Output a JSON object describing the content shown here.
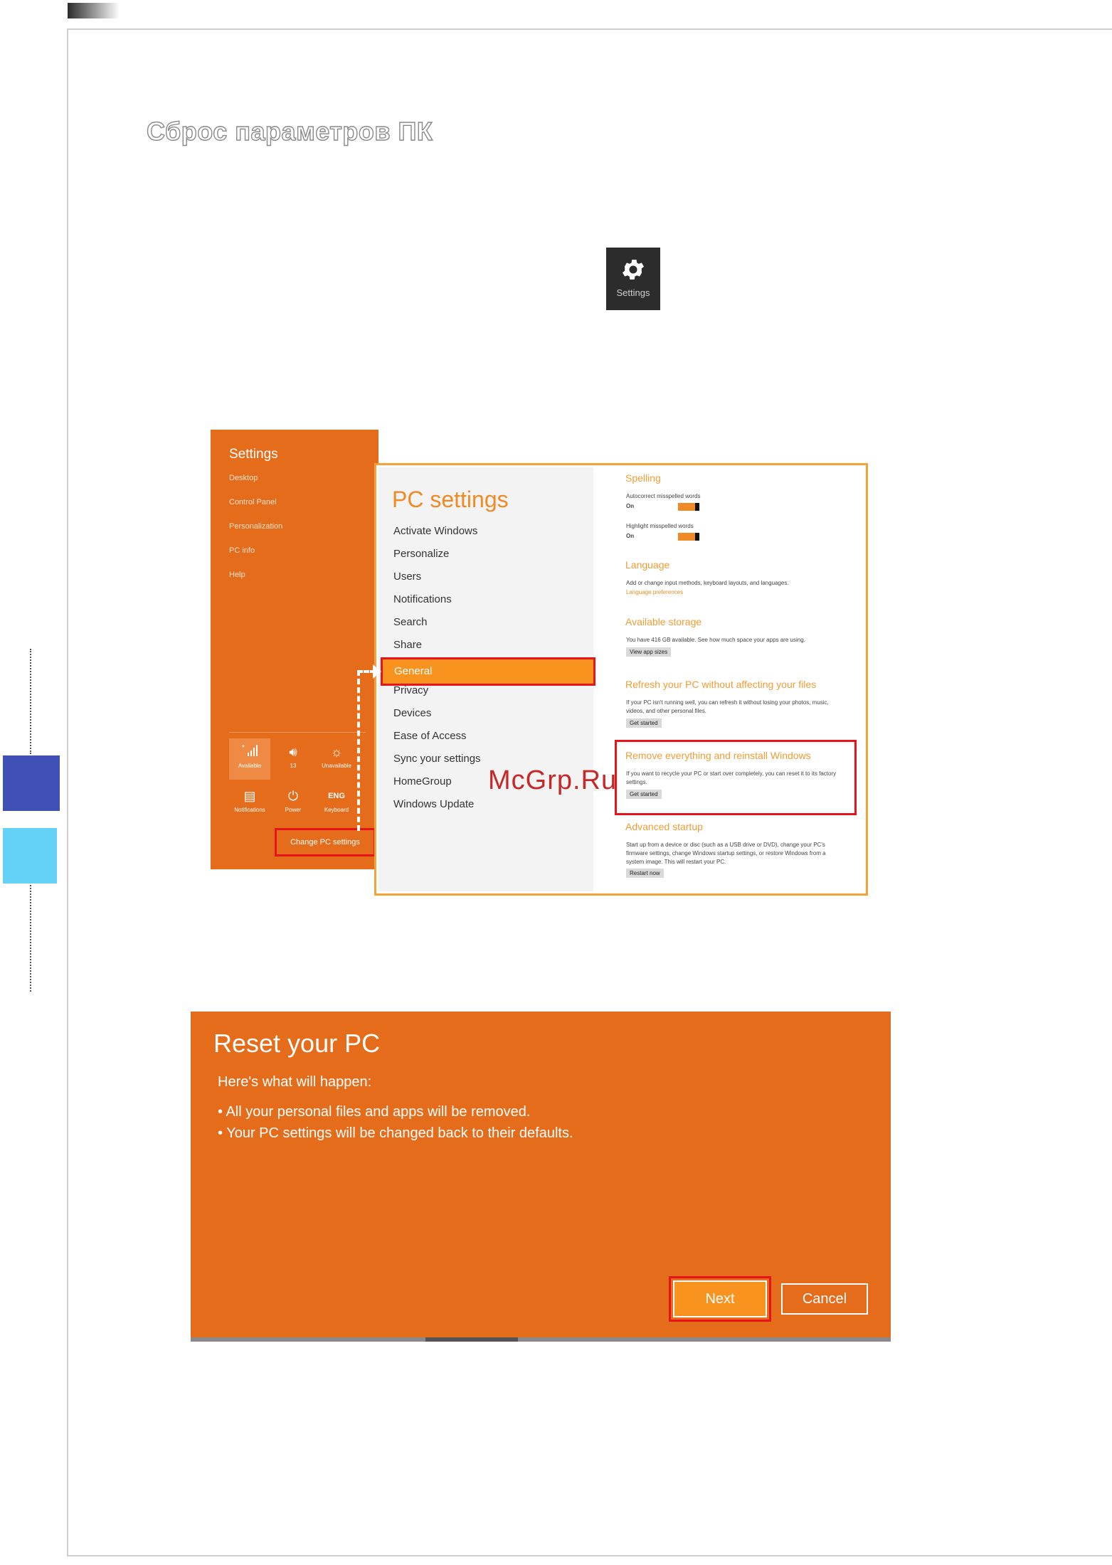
{
  "heading": "Сброс параметров ПК",
  "settings_tile": {
    "label": "Settings"
  },
  "charm": {
    "title": "Settings",
    "links": [
      "Desktop",
      "Control Panel",
      "Personalization",
      "PC info",
      "Help"
    ],
    "quick": [
      {
        "icon": "signal-icon",
        "label": "Available"
      },
      {
        "icon": "volume-icon",
        "label": "13"
      },
      {
        "icon": "brightness-icon",
        "label": "Unavailable"
      },
      {
        "icon": "notifications-icon",
        "label": "Notifications"
      },
      {
        "icon": "power-icon",
        "label": "Power"
      },
      {
        "icon": "keyboard-icon",
        "label": "Keyboard",
        "glyph": "ENG"
      }
    ],
    "change_pc": "Change PC settings"
  },
  "pc_settings": {
    "title": "PC settings",
    "nav": [
      "Activate Windows",
      "Personalize",
      "Users",
      "Notifications",
      "Search",
      "Share",
      "General",
      "Privacy",
      "Devices",
      "Ease of Access",
      "Sync your settings",
      "HomeGroup",
      "Windows Update"
    ],
    "selected": "General",
    "right": {
      "spelling_h": "Spelling",
      "autocorrect": "Autocorrect misspelled words",
      "highlight": "Highlight misspelled words",
      "on": "On",
      "language_h": "Language",
      "language_text": "Add or change input methods, keyboard layouts, and languages.",
      "language_link": "Language preferences",
      "storage_h": "Available storage",
      "storage_text": "You have 416 GB available. See how much space your apps are using.",
      "view_sizes": "View app sizes",
      "refresh_h": "Refresh your PC without affecting your files",
      "refresh_text1": "If your PC isn't running well, you can refresh it without losing your photos, music,",
      "refresh_text2": "videos, and other personal files.",
      "get_started": "Get started",
      "remove_h": "Remove everything and reinstall Windows",
      "remove_text1": "If you want to recycle your PC or start over completely, you can reset it to its factory",
      "remove_text2": "settings.",
      "advanced_h": "Advanced startup",
      "advanced_text1": "Start up from a device or disc (such as a USB drive or DVD), change your PC's",
      "advanced_text2": "firmware settings, change Windows startup settings, or restore Windows from a",
      "advanced_text3": "system image. This will restart your PC.",
      "restart_now": "Restart now"
    }
  },
  "watermark": "McGrp.Ru",
  "reset": {
    "title": "Reset your PC",
    "subtitle": "Here's what will happen:",
    "bullets": [
      "• All your personal files and apps will be removed.",
      "• Your PC settings will be changed back to their defaults."
    ],
    "next": "Next",
    "cancel": "Cancel"
  },
  "colors": {
    "orange": "#e46c1a",
    "highlight_red": "#e8141b",
    "accent_orange": "#f7931e",
    "tab_dark": "#3f51b5",
    "tab_light": "#64d2f7"
  }
}
